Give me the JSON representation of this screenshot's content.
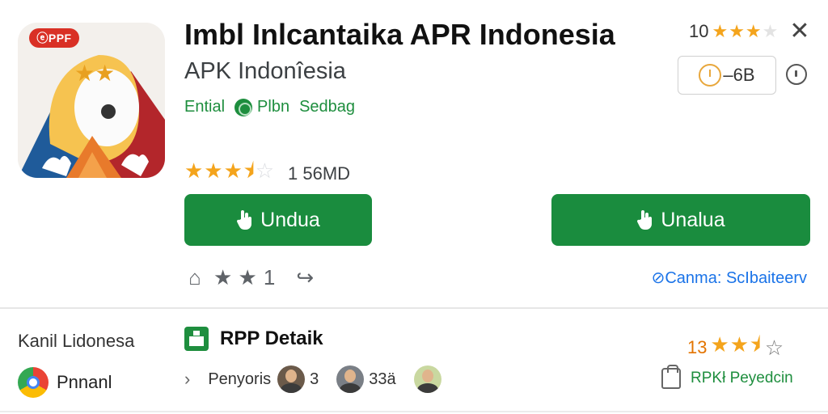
{
  "app": {
    "badge": "ⓔPPF",
    "title": "Imbl Inlcantaika APR Indonesia",
    "subtitle": "APK Indonîesia",
    "tags": [
      "Ential",
      "Plbn",
      "Sedbag"
    ],
    "rating_stars": "★★★⯨",
    "rating_dim": "☆",
    "downloads": "1 56MD"
  },
  "buttons": {
    "primary_label": "Undua",
    "secondary_label": "Unalua"
  },
  "actions": {
    "home_icon": "⌂",
    "stars": "★ ★",
    "count": "1",
    "share_icon": "↪"
  },
  "compat_link": "⊘Canma: ScIbaiteerv",
  "top_right": {
    "rating_num": "10",
    "stars": "★★★",
    "stars_dim": "★",
    "close": "✕",
    "size_label": "–6B"
  },
  "bottom": {
    "left_title": "Kanil Lidonesa",
    "left_item": "Pnnanl",
    "detail_title": "RPP Detaik",
    "developer_label": "Penyoris",
    "dev_counts": [
      "3",
      "33ä"
    ],
    "rating_num": "13",
    "rating_stars": "★★⯨",
    "rating_outline": "☆",
    "link_label": "RPKł Peyedcin"
  },
  "colors": {
    "accent_green": "#1a8c3e",
    "star": "#f4a41c",
    "link_blue": "#1a73e8",
    "badge_red": "#d93025"
  }
}
